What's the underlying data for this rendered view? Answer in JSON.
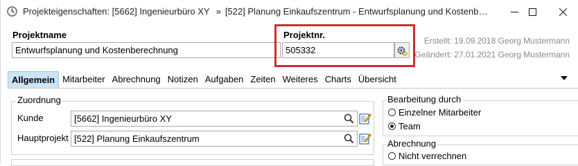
{
  "window": {
    "title_project": "Projekteigenschaften: [5662] Ingenieurbüro XY",
    "title_separator": "»",
    "title_subproject": "[522] Planung Einkaufszentrum - Entwurfsplanung und Kostenb…"
  },
  "header": {
    "projektname_label": "Projektname",
    "projektname_value": "Entwurfsplanung und Kostenberechnung",
    "projektnr_label": "Projektnr.",
    "projektnr_value": "505332",
    "erstellt": "Erstellt: 19.09.2018 Georg Mustermann",
    "geaendert": "Geändert: 27.01.2021 Georg Mustermann"
  },
  "tabs": [
    "Allgemein",
    "Mitarbeiter",
    "Abrechnung",
    "Notizen",
    "Aufgaben",
    "Zeiten",
    "Weiteres",
    "Charts",
    "Übersicht"
  ],
  "zuordnung": {
    "title": "Zuordnung",
    "kunde_label": "Kunde",
    "kunde_value": "[5662] Ingenieurbüro XY",
    "hauptprojekt_label": "Hauptprojekt",
    "hauptprojekt_value": "[522] Planung Einkaufszentrum"
  },
  "bearbeitung": {
    "title": "Bearbeitung durch",
    "option1": "Einzelner Mitarbeiter",
    "option2": "Team",
    "selected": "Team"
  },
  "abrechnung": {
    "title": "Abrechnung",
    "option1": "Nicht verrechnen"
  },
  "colors": {
    "highlight": "#cc2e35",
    "active_tab": "#cce4f7"
  }
}
